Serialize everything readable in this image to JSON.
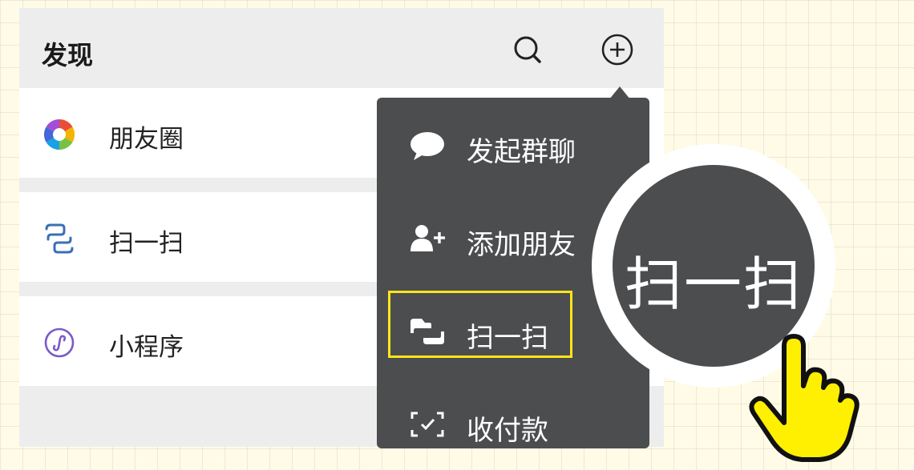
{
  "header": {
    "title": "发现",
    "search_icon": "search-icon",
    "add_icon": "plus-circle-icon"
  },
  "discover_list": [
    {
      "label": "朋友圈",
      "icon": "moments-icon"
    },
    {
      "label": "扫一扫",
      "icon": "scan-icon"
    },
    {
      "label": "小程序",
      "icon": "mini-program-icon"
    }
  ],
  "popup_menu": {
    "items": [
      {
        "label": "发起群聊",
        "icon": "chat-bubble-icon"
      },
      {
        "label": "添加朋友",
        "icon": "add-friend-icon"
      },
      {
        "label": "扫一扫",
        "icon": "scan-icon"
      },
      {
        "label": "收付款",
        "icon": "payment-icon"
      }
    ],
    "highlighted_index": 2,
    "highlight_color": "#ffe61a",
    "background_color": "#4c4d4f"
  },
  "zoom_callout": {
    "label": "扫一扫"
  },
  "pointer": {
    "icon": "pointing-hand-icon",
    "color": "#ffef00"
  }
}
